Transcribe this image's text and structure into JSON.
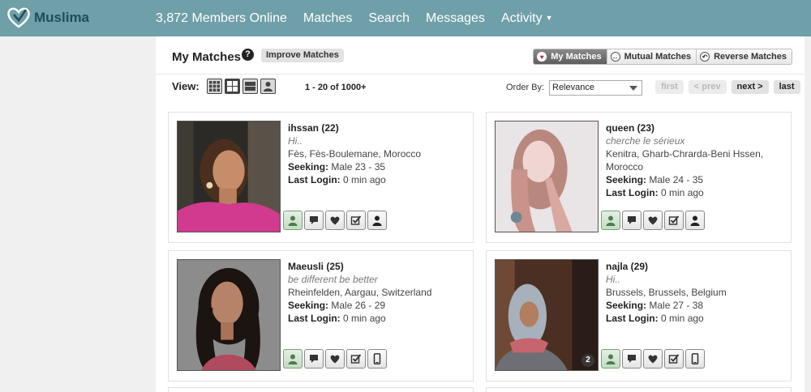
{
  "brand": {
    "name": "Muslima"
  },
  "nav": {
    "members_online": "3,872 Members Online",
    "items": [
      "Matches",
      "Search",
      "Messages",
      "Activity"
    ],
    "activity_caret": "▼"
  },
  "header": {
    "title": "My Matches",
    "help": "?",
    "improve_label": "Improve Matches",
    "tabs": [
      {
        "label": "My Matches",
        "active": true
      },
      {
        "label": "Mutual Matches",
        "active": false
      },
      {
        "label": "Reverse Matches",
        "active": false
      }
    ]
  },
  "toolbar": {
    "view_label": "View:",
    "range": "1 - 20 of 1000+",
    "order_by_label": "Order By:",
    "order_by_value": "Relevance",
    "pager": {
      "first": "first",
      "prev": "< prev",
      "next": "next >",
      "last": "last"
    }
  },
  "labels": {
    "seeking": "Seeking:",
    "last_login": "Last Login:"
  },
  "profiles": [
    {
      "name": "ihssan (22)",
      "tagline": "Hi..",
      "location": "Fès, Fès-Boulemane, Morocco",
      "seeking": "Male 23 - 35",
      "last_login": "0 min ago",
      "photo_count": ""
    },
    {
      "name": "queen (23)",
      "tagline": "cherche le sérieux",
      "location": "Kenitra, Gharb-Chrarda-Beni Hssen, Morocco",
      "seeking": "Male 24 - 35",
      "last_login": "0 min ago",
      "photo_count": ""
    },
    {
      "name": "Maeusli (25)",
      "tagline": "be different be better",
      "location": "Rheinfelden, Aargau, Switzerland",
      "seeking": "Male 26 - 29",
      "last_login": "0 min ago",
      "photo_count": ""
    },
    {
      "name": "najla (29)",
      "tagline": "Hi..",
      "location": "Brussels, Brussels, Belgium",
      "seeking": "Male 27 - 38",
      "last_login": "0 min ago",
      "photo_count": "2"
    }
  ],
  "colors": {
    "topbar": "#6f9fa9",
    "logo_text": "#1e4e57",
    "green_action": "#c5dcc5"
  }
}
